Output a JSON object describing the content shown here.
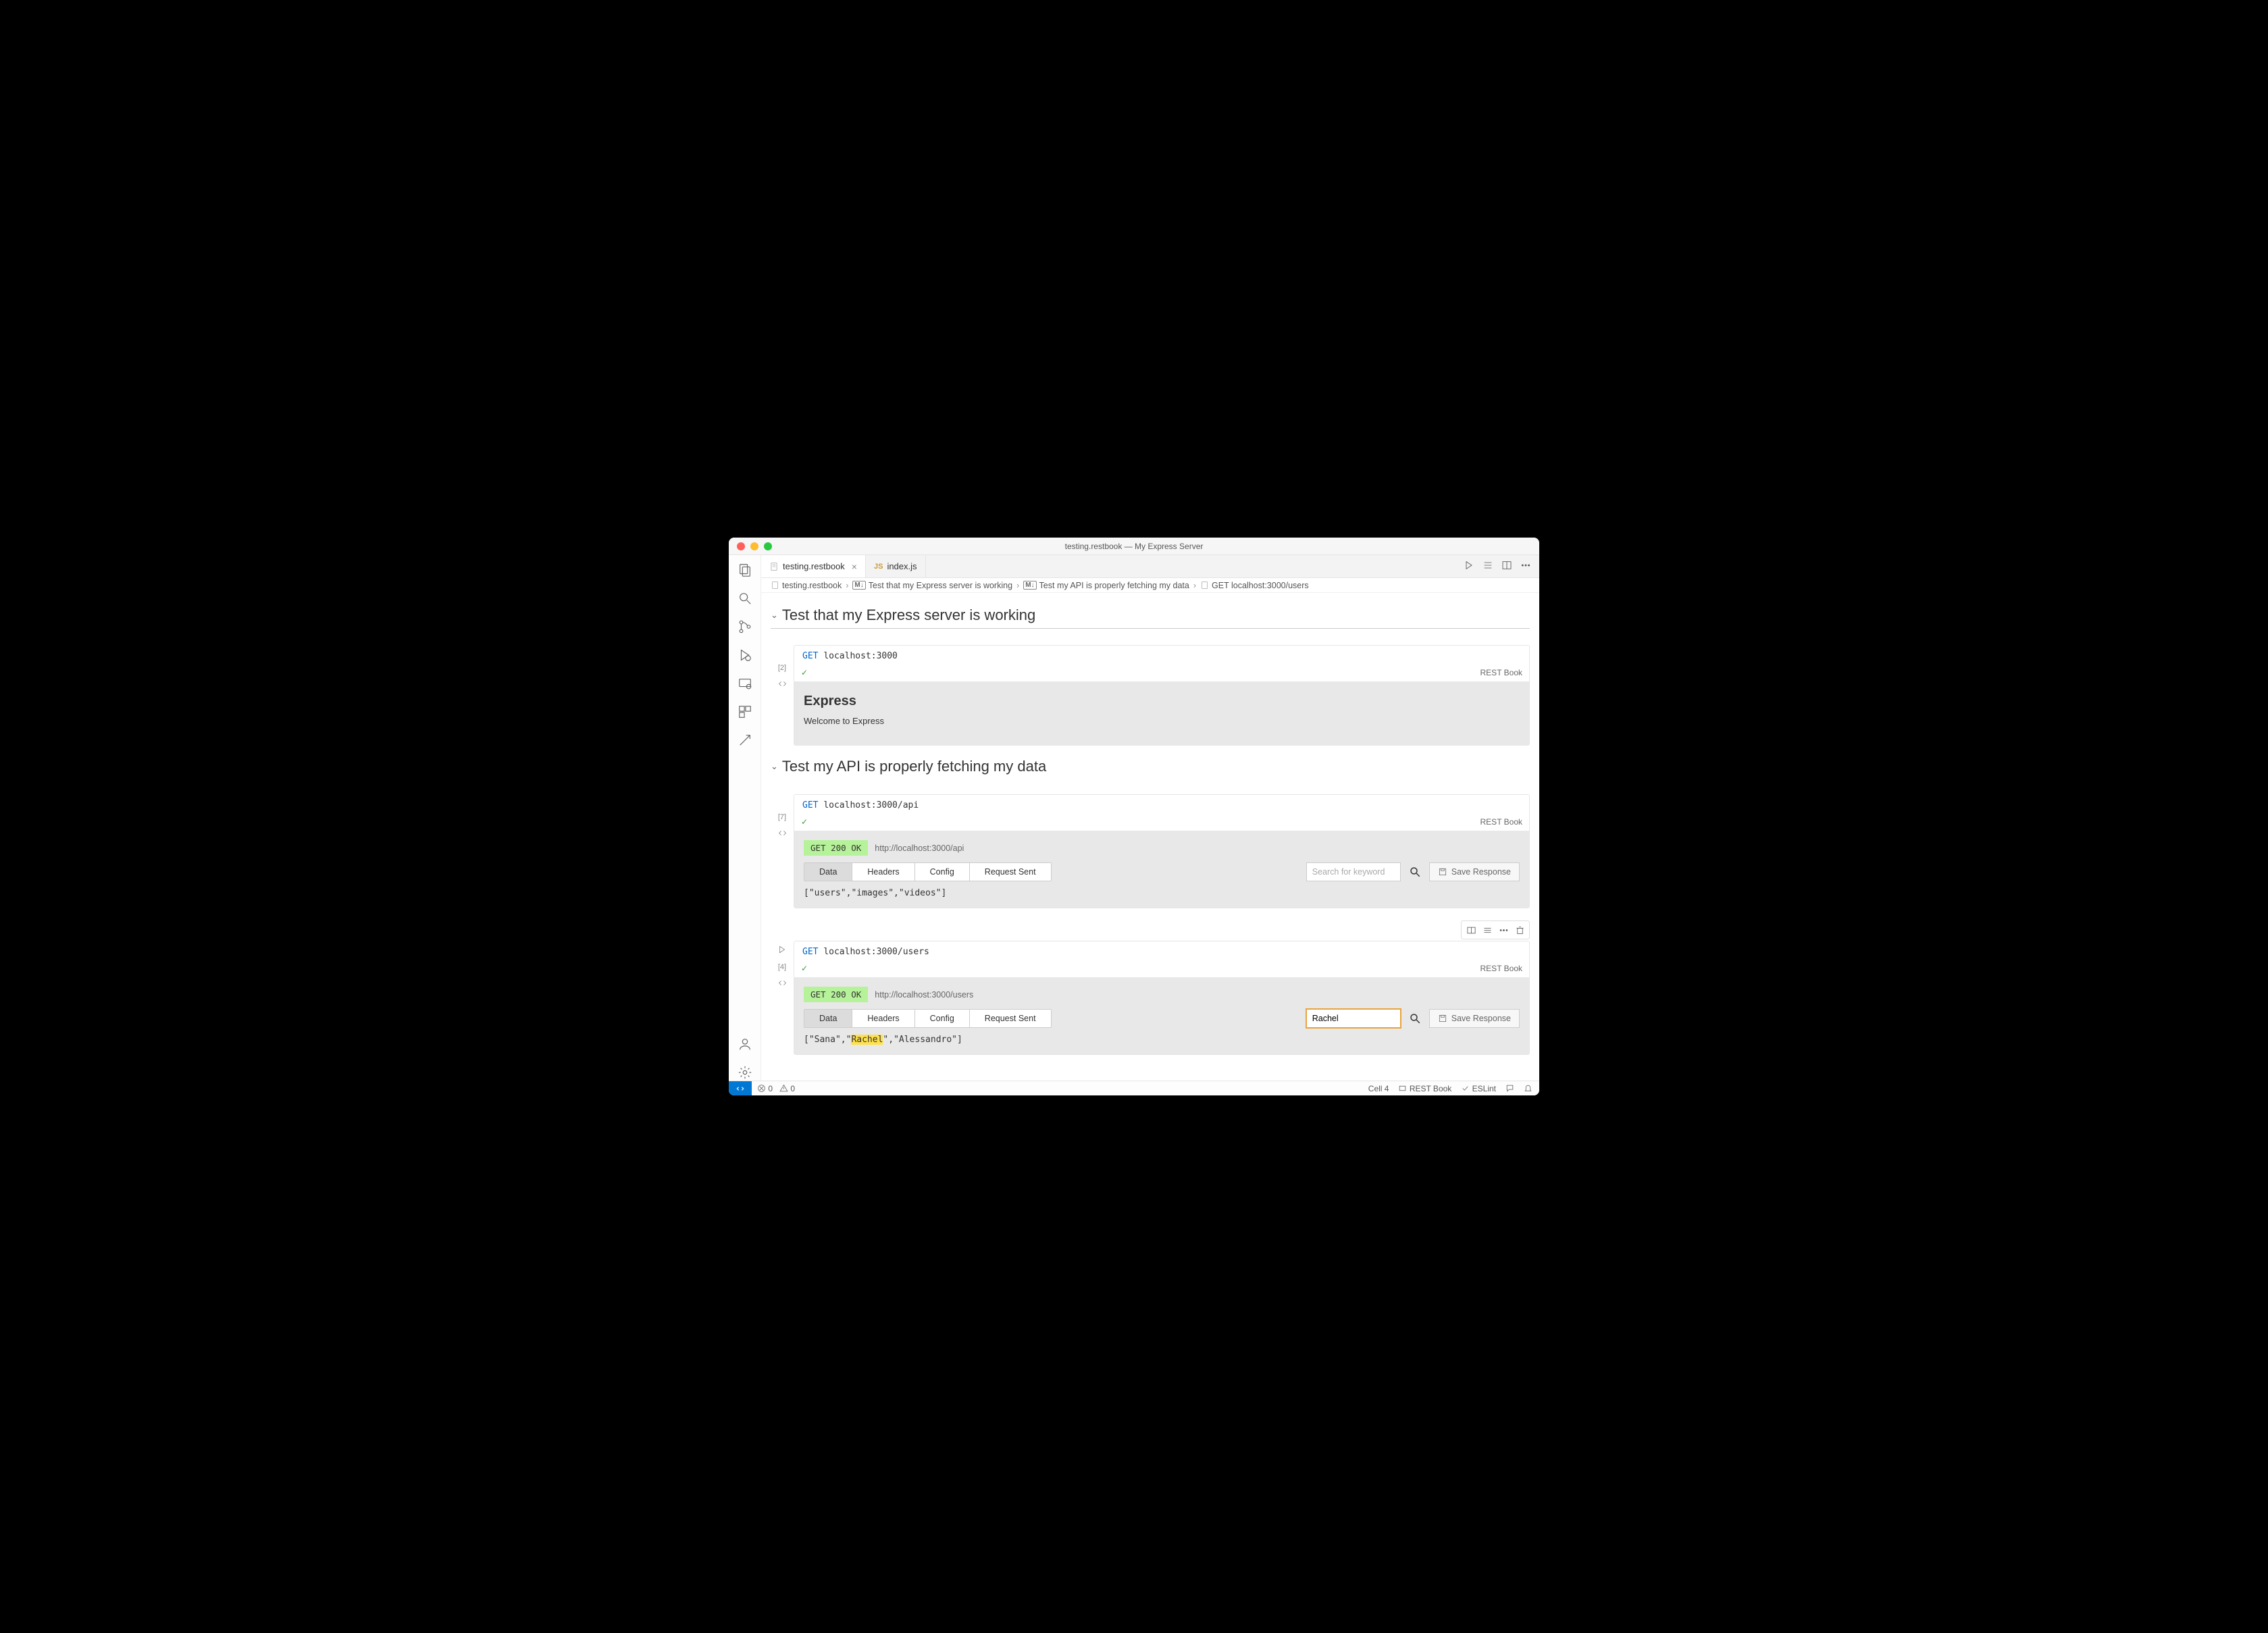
{
  "window": {
    "title": "testing.restbook — My Express Server"
  },
  "tabs": [
    {
      "label": "testing.restbook",
      "active": true,
      "closable": true
    },
    {
      "label": "index.js",
      "active": false,
      "closable": false
    }
  ],
  "breadcrumbs": {
    "file": "testing.restbook",
    "h1": "Test that my Express server is working",
    "h2": "Test my API is properly fetching my data",
    "cell": "GET localhost:3000/users"
  },
  "sections": [
    {
      "title": "Test that my Express server is working"
    },
    {
      "title": "Test my API is properly fetching my data"
    }
  ],
  "cells": [
    {
      "exec": "[2]",
      "method": "GET",
      "url": "localhost:3000",
      "kernel": "REST Book",
      "output_kind": "html",
      "output_heading": "Express",
      "output_body": "Welcome to Express"
    },
    {
      "exec": "[7]",
      "method": "GET",
      "url": "localhost:3000/api",
      "kernel": "REST Book",
      "badge": "GET 200 OK",
      "full_url": "http://localhost:3000/api",
      "tabs": [
        "Data",
        "Headers",
        "Config",
        "Request Sent"
      ],
      "search_placeholder": "Search for keyword",
      "search_value": "",
      "save_label": "Save Response",
      "json": "[\"users\",\"images\",\"videos\"]"
    },
    {
      "exec": "[4]",
      "method": "GET",
      "url": "localhost:3000/users",
      "kernel": "REST Book",
      "badge": "GET 200 OK",
      "full_url": "http://localhost:3000/users",
      "tabs": [
        "Data",
        "Headers",
        "Config",
        "Request Sent"
      ],
      "search_placeholder": "",
      "search_value": "Rachel",
      "save_label": "Save Response",
      "json_pre": "[\"Sana\",\"",
      "json_hl": "Rachel",
      "json_post": "\",\"Alessandro\"]"
    }
  ],
  "statusbar": {
    "errors": "0",
    "warnings": "0",
    "cell": "Cell 4",
    "kernel": "REST Book",
    "eslint": "ESLint"
  }
}
